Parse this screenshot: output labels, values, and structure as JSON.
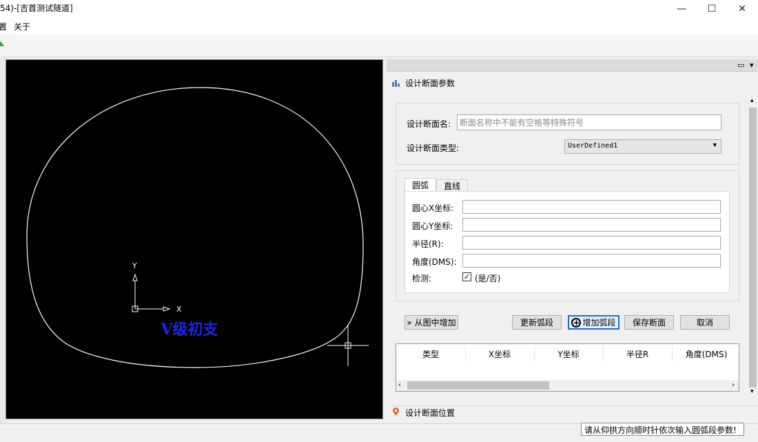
{
  "window": {
    "title": "54)-[吉首测试隧道]",
    "minimize_glyph": "—",
    "maximize_glyph": "☐",
    "close_glyph": "✕"
  },
  "menu": {
    "items": [
      "置",
      "关于"
    ]
  },
  "canvas": {
    "label": "V级初支",
    "axis_x": "X",
    "axis_y": "Y",
    "label_color": "#1e26e6"
  },
  "panel": {
    "section1_title": "设计断面参数",
    "section_name_label": "设计断面名:",
    "section_name_placeholder": "断面名称中不能有空格等特殊符号",
    "section_type_label": "设计断面类型:",
    "section_type_value": "UserDefined1",
    "tabs": [
      "圆弧",
      "直线"
    ],
    "fields": {
      "center_x": "圆心X坐标:",
      "center_y": "圆心Y坐标:",
      "radius": "半径(R):",
      "angle": "角度(DMS):",
      "check": "检测:",
      "check_option": "(是/否)"
    },
    "check_value": true,
    "buttons": {
      "add_from_drawing": "» 从图中增加",
      "update_arc": "更新弧段",
      "add_arc": "增加弧段",
      "save_section": "保存断面",
      "cancel": "取消"
    },
    "table_headers": [
      "类型",
      "X坐标",
      "Y坐标",
      "半径R",
      "角度(DMS)"
    ],
    "section2_title": "设计断面位置"
  },
  "status": {
    "message": "请从仰拱方向顺时针依次输入圆弧段参数!"
  }
}
